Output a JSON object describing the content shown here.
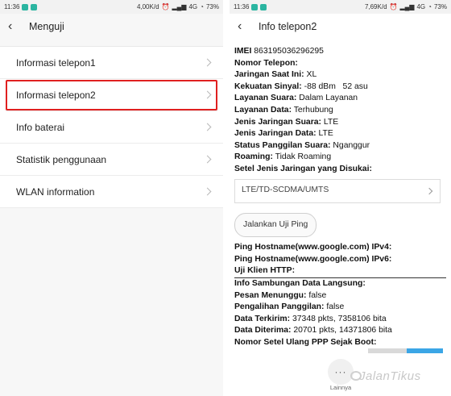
{
  "left": {
    "status": {
      "time": "11:36",
      "speed": "4,00K/d",
      "network": "4G",
      "battery": "73%"
    },
    "title": "Menguji",
    "items": [
      {
        "label": "Informasi telepon1",
        "highlighted": false
      },
      {
        "label": "Informasi telepon2",
        "highlighted": true
      },
      {
        "label": "Info baterai",
        "highlighted": false
      },
      {
        "label": "Statistik penggunaan",
        "highlighted": false
      },
      {
        "label": "WLAN information",
        "highlighted": false
      }
    ]
  },
  "right": {
    "status": {
      "time": "11:36",
      "speed": "7,69K/d",
      "network": "4G",
      "battery": "73%"
    },
    "title": "Info telepon2",
    "rows_top": [
      {
        "key": "IMEI",
        "value": "863195036296295"
      },
      {
        "key": "Nomor Telepon:",
        "value": ""
      },
      {
        "key": "Jaringan Saat Ini:",
        "value": "XL"
      },
      {
        "key": "Kekuatan Sinyal:",
        "value": "-88 dBm   52 asu"
      },
      {
        "key": "Layanan Suara:",
        "value": "Dalam Layanan"
      },
      {
        "key": "Layanan Data:",
        "value": "Terhubung"
      },
      {
        "key": "Jenis Jaringan Suara:",
        "value": "LTE"
      },
      {
        "key": "Jenis Jaringan Data:",
        "value": "LTE"
      },
      {
        "key": "Status Panggilan Suara:",
        "value": "Nganggur"
      },
      {
        "key": "Roaming:",
        "value": "Tidak Roaming"
      },
      {
        "key": "Setel Jenis Jaringan yang Disukai:",
        "value": ""
      }
    ],
    "network_select": "LTE/TD-SCDMA/UMTS",
    "ping_button": "Jalankan Uji Ping",
    "rows_ping": [
      {
        "key": "Ping Hostname(www.google.com) IPv4:",
        "value": ""
      },
      {
        "key": "Ping Hostname(www.google.com) IPv6:",
        "value": ""
      },
      {
        "key": "Uji Klien HTTP:",
        "value": ""
      }
    ],
    "rows_bottom": [
      {
        "key": "Info Sambungan Data Langsung:",
        "value": ""
      },
      {
        "key": "Pesan Menunggu:",
        "value": "false"
      },
      {
        "key": "Pengalihan Panggilan:",
        "value": "false"
      },
      {
        "key": "Data Terkirim:",
        "value": "37348 pkts, 7358106 bita"
      },
      {
        "key": "Data Diterima:",
        "value": "20701 pkts, 14371806 bita"
      },
      {
        "key": "Nomor Setel Ulang PPP Sejak Boot:",
        "value": ""
      }
    ],
    "more_label": "Lainnya"
  },
  "watermark": "JalanTikus",
  "colors": {
    "highlight": "#e02020",
    "accent": "#3ba6e6"
  }
}
